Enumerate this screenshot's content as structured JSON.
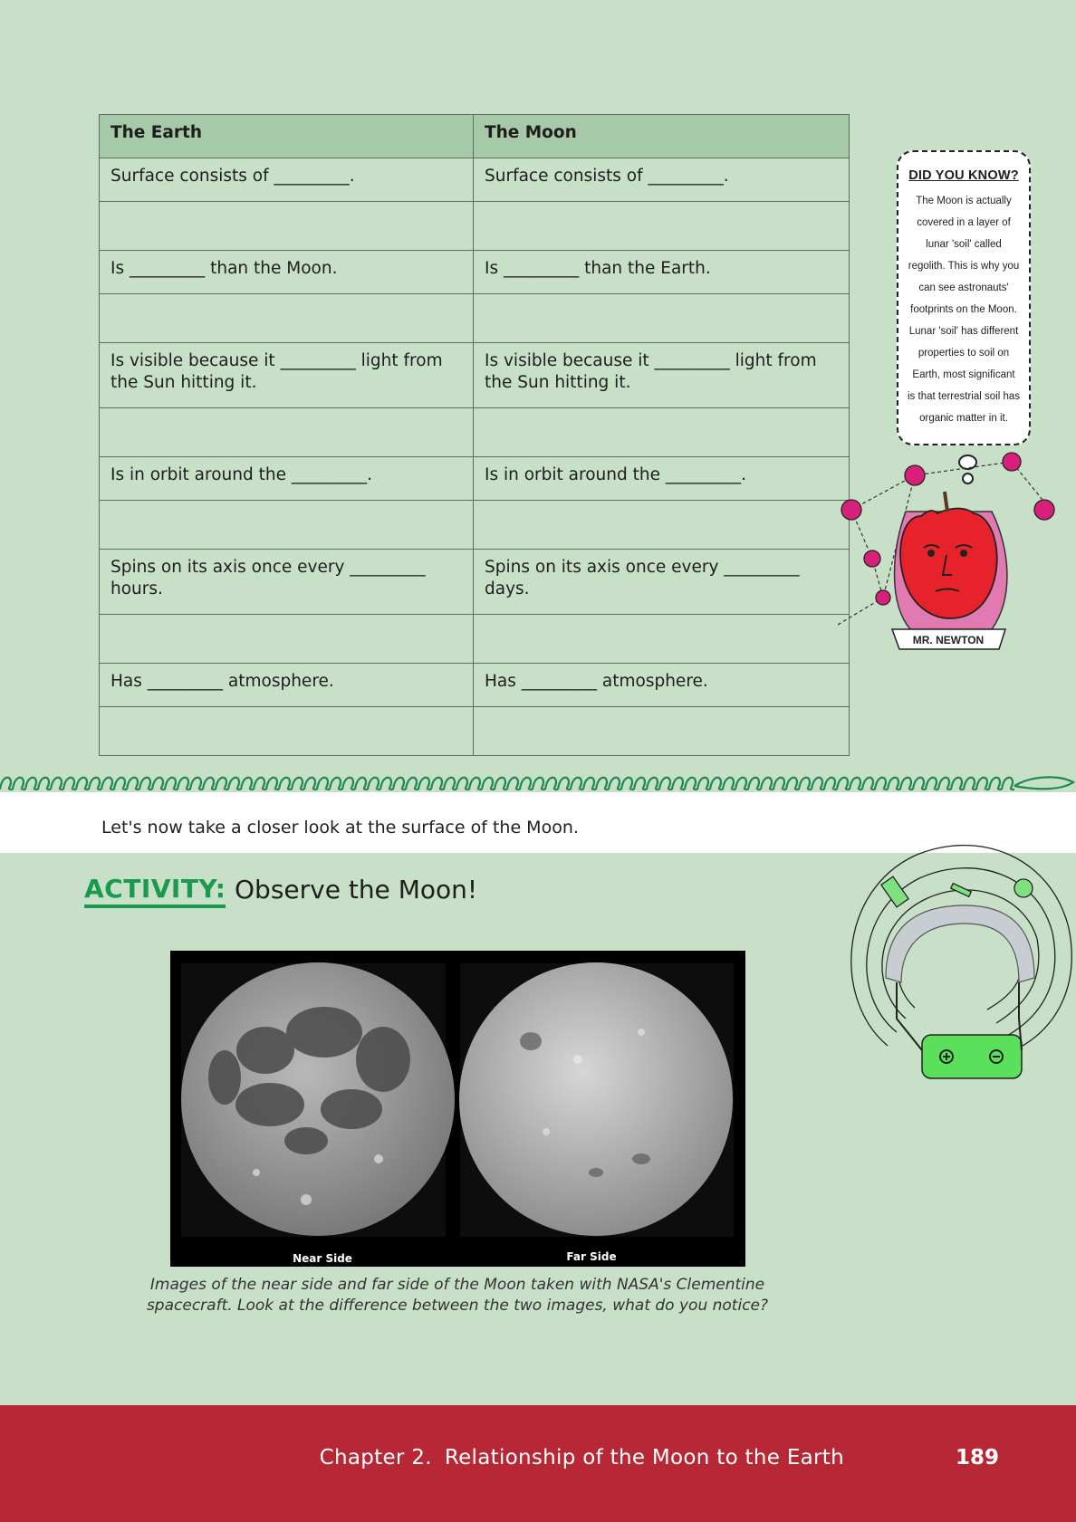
{
  "table": {
    "headers": [
      "The Earth",
      "The Moon"
    ],
    "rows": [
      {
        "earth": "Surface consists of _________.",
        "moon": "Surface consists of _________.",
        "kind": "q"
      },
      {
        "earth": "",
        "moon": "",
        "kind": "spacer"
      },
      {
        "earth": "Is _________ than the Moon.",
        "moon": "Is _________ than the Earth.",
        "kind": "q"
      },
      {
        "earth": "",
        "moon": "",
        "kind": "spacer"
      },
      {
        "earth": "Is visible because it _________ light from the Sun hitting it.",
        "moon": "Is visible because it _________ light from the Sun hitting it.",
        "kind": "two"
      },
      {
        "earth": "",
        "moon": "",
        "kind": "spacer"
      },
      {
        "earth": "Is in orbit around the _________.",
        "moon": "Is in orbit around the _________.",
        "kind": "q"
      },
      {
        "earth": "",
        "moon": "",
        "kind": "spacer"
      },
      {
        "earth": "Spins on its axis once every _________ hours.",
        "moon": "Spins on its axis once every _________ days.",
        "kind": "two"
      },
      {
        "earth": "",
        "moon": "",
        "kind": "spacer"
      },
      {
        "earth": "Has _________ atmosphere.",
        "moon": "Has _________ atmosphere.",
        "kind": "q"
      },
      {
        "earth": "",
        "moon": "",
        "kind": "spacer"
      }
    ]
  },
  "did_you_know": {
    "title": "DID YOU KNOW?",
    "body": "The Moon is actually covered in a layer of lunar 'soil' called regolith. This is why you can see astronauts' footprints on the Moon. Lunar 'soil' has different properties to soil on Earth, most significant is that terrestrial soil has organic matter in it."
  },
  "newton_label": "MR. NEWTON",
  "intro_text": "Let's now take a closer look at the surface of the Moon.",
  "activity": {
    "label": "ACTIVITY:",
    "title": "Observe the Moon!"
  },
  "moon_image": {
    "near_label": "Near Side",
    "far_label": "Far Side"
  },
  "caption": "Images of the near side and far side of the Moon taken with NASA's Clementine spacecraft. Look at the difference between the two images, what do you notice?",
  "footer": {
    "chapter_number": "Chapter 2.",
    "chapter_title": "Relationship of the Moon to the Earth",
    "page_number": "189"
  },
  "colors": {
    "background": "#c8dfc8",
    "table_header": "#a6c9a8",
    "activity_green": "#1a9a4c",
    "footer_red": "#b82735"
  }
}
